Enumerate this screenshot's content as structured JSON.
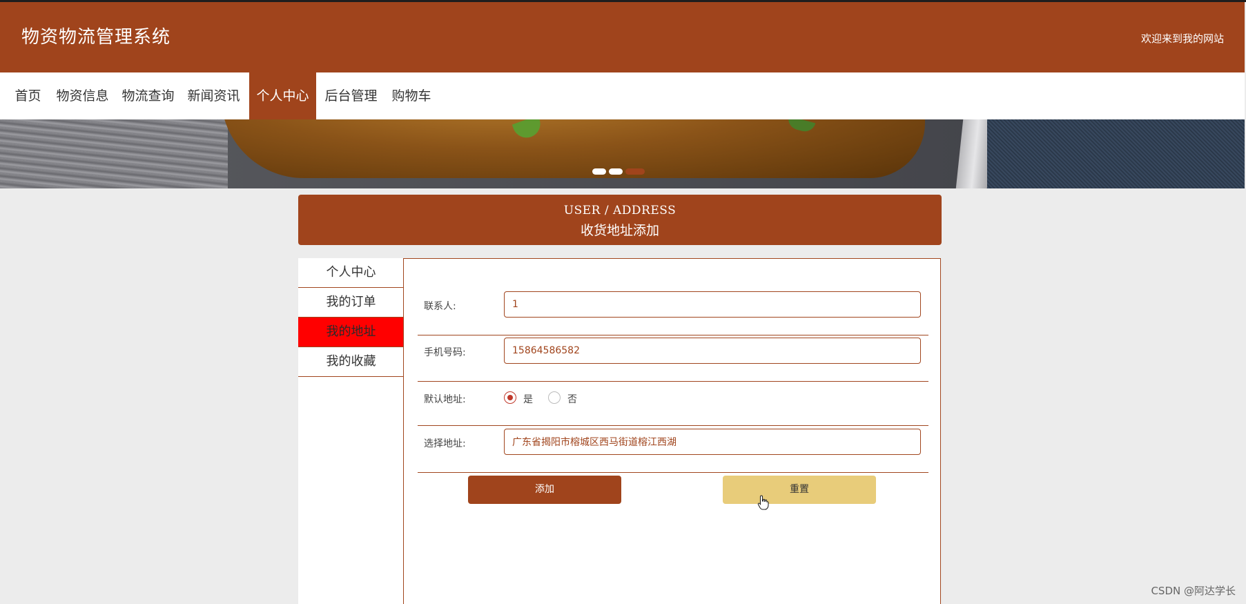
{
  "header": {
    "title": "物资物流管理系统",
    "welcome": "欢迎来到我的网站"
  },
  "nav": {
    "items": [
      "首页",
      "物资信息",
      "物流查询",
      "新闻资讯",
      "个人中心",
      "后台管理",
      "购物车"
    ],
    "active": "个人中心"
  },
  "banner": {
    "slides": 3,
    "active_slide": 3
  },
  "page_title": {
    "en": "USER / ADDRESS",
    "zh": "收货地址添加"
  },
  "sidebar": {
    "items": [
      "个人中心",
      "我的订单",
      "我的地址",
      "我的收藏"
    ],
    "active": "我的地址"
  },
  "form": {
    "contact_label": "联系人:",
    "contact_value": "1",
    "phone_label": "手机号码:",
    "phone_value": "15864586582",
    "default_label": "默认地址:",
    "default_yes": "是",
    "default_no": "否",
    "default_selected": "是",
    "address_label": "选择地址:",
    "address_value": "广东省揭阳市榕城区西马街道榕江西湖"
  },
  "buttons": {
    "add": "添加",
    "reset": "重置"
  },
  "colors": {
    "brand": "#a0441c",
    "active_sidebar": "#ff0000",
    "reset_button": "#e8cc7a"
  },
  "watermark": "CSDN @阿达学长"
}
